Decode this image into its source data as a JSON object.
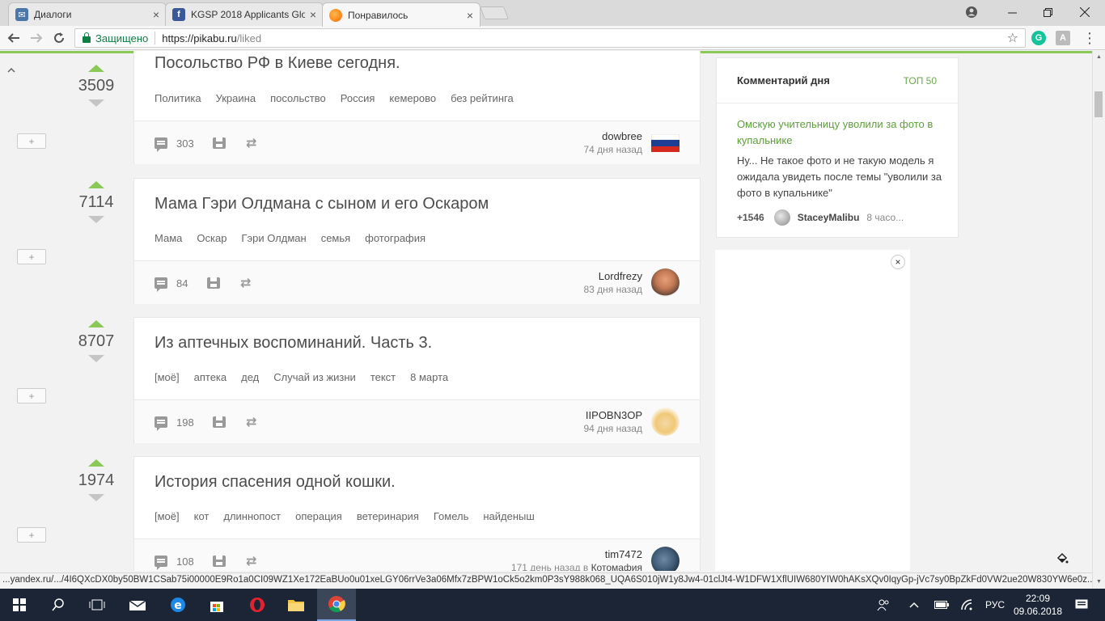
{
  "browser": {
    "tabs": [
      {
        "title": "Диалоги",
        "icon": "vk-icon",
        "color": "#4a76a8",
        "active": false
      },
      {
        "title": "KGSP 2018 Applicants Glo",
        "icon": "facebook-icon",
        "color": "#3b5998",
        "active": false
      },
      {
        "title": "Понравилось",
        "icon": "pikabu-icon",
        "color": "#ff6a00",
        "active": true
      }
    ],
    "close_glyph": "×",
    "secure_label": "Защищено",
    "url_host": "https://pikabu.ru",
    "url_path": "/liked",
    "status_url": "...yandex.ru/.../4I6QXcDX0by50BW1CSab75i00000E9Ro1a0CI09WZ1Xe172EaBUo0u01xeLGY06rrVe3a06Mfx7zBPW1oCk5o2km0P3sY988k068_UQA6S010jW1y8Jw4-01clJt4-W1DFW1XflUIW680YIW0hAKsXQv0IqyGp-jVc7sy0BpZkFd0VW2ue20W830YW6e0z..."
  },
  "stories": [
    {
      "rating": "3509",
      "title": "Посольство РФ в Киеве сегодня.",
      "tags": [
        "Политика",
        "Украина",
        "посольство",
        "Россия",
        "кемерово",
        "без рейтинга"
      ],
      "comments": "303",
      "author": "dowbree",
      "time": "74 дня назад",
      "time_extra": "",
      "avatar": "flag"
    },
    {
      "rating": "7114",
      "title": "Мама Гэри Олдмана с сыном и его Оскаром",
      "tags": [
        "Мама",
        "Оскар",
        "Гэри Олдман",
        "семья",
        "фотография"
      ],
      "comments": "84",
      "author": "Lordfrezy",
      "time": "83 дня назад",
      "time_extra": "",
      "avatar": "face"
    },
    {
      "rating": "8707",
      "title": "Из аптечных воспоминаний. Часть 3.",
      "tags": [
        "[моё]",
        "аптека",
        "дед",
        "Случай из жизни",
        "текст",
        "8 марта"
      ],
      "comments": "198",
      "author": "IIPOBN3OP",
      "time": "94 дня назад",
      "time_extra": "",
      "avatar": "chef"
    },
    {
      "rating": "1974",
      "title": "История спасения одной кошки.",
      "tags": [
        "[моё]",
        "кот",
        "длиннопост",
        "операция",
        "ветеринария",
        "Гомель",
        "найденыш"
      ],
      "comments": "108",
      "author": "tim7472",
      "time": "171 день назад в ",
      "time_extra": "Котомафия",
      "avatar": "dark"
    }
  ],
  "plus_label": "+",
  "comment_of_day": {
    "title": "Комментарий дня",
    "top_link": "ТОП 50",
    "post_link": "Омскую учительницу уволили за фото в купальнике",
    "text": "Ну... Не такое фото и не такую модель я ожидала увидеть после темы \"уволили за фото в купальнике\"",
    "score": "+1546",
    "user": "StaceyMalibu",
    "time": "8 часо..."
  },
  "ad_close": "×",
  "taskbar": {
    "lang": "РУС",
    "time": "22:09",
    "date": "09.06.2018"
  }
}
